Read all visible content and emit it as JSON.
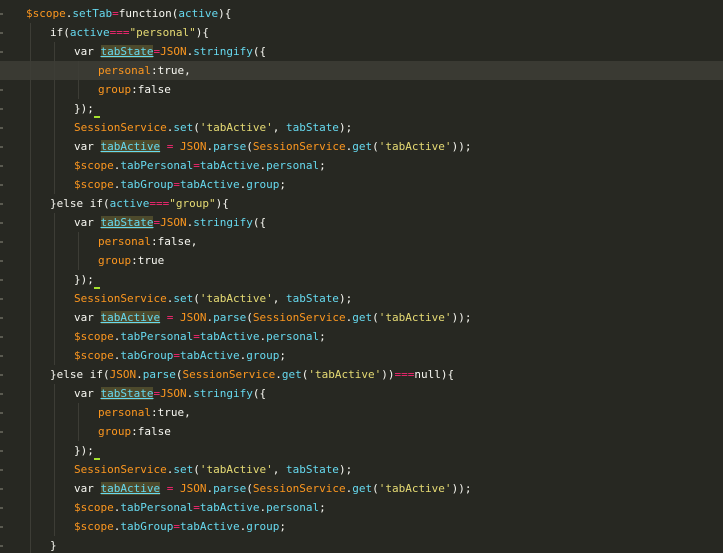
{
  "editor": {
    "top_fragment": "",
    "lines": [
      {
        "text": "$scope.setTab=function(active){",
        "indent": 0
      },
      {
        "text": "if(active===\"personal\"){",
        "indent": 1
      },
      {
        "text": "var tabState=JSON.stringify({",
        "indent": 2
      },
      {
        "text": "personal:true,",
        "indent": 3
      },
      {
        "text": "group:false",
        "indent": 3
      },
      {
        "text": "});",
        "indent": 2
      },
      {
        "text": "SessionService.set('tabActive', tabState);",
        "indent": 2
      },
      {
        "text": "var tabActive = JSON.parse(SessionService.get('tabActive'));",
        "indent": 2
      },
      {
        "text": "$scope.tabPersonal=tabActive.personal;",
        "indent": 2
      },
      {
        "text": "$scope.tabGroup=tabActive.group;",
        "indent": 2
      },
      {
        "text": "}else if(active===\"group\"){",
        "indent": 1
      },
      {
        "text": "var tabState=JSON.stringify({",
        "indent": 2
      },
      {
        "text": "personal:false,",
        "indent": 3
      },
      {
        "text": "group:true",
        "indent": 3
      },
      {
        "text": "});",
        "indent": 2
      },
      {
        "text": "SessionService.set('tabActive', tabState);",
        "indent": 2
      },
      {
        "text": "var tabActive = JSON.parse(SessionService.get('tabActive'));",
        "indent": 2
      },
      {
        "text": "$scope.tabPersonal=tabActive.personal;",
        "indent": 2
      },
      {
        "text": "$scope.tabGroup=tabActive.group;",
        "indent": 2
      },
      {
        "text": "}else if(JSON.parse(SessionService.get('tabActive'))===null){",
        "indent": 1
      },
      {
        "text": "var tabState=JSON.stringify({",
        "indent": 2
      },
      {
        "text": "personal:true,",
        "indent": 3
      },
      {
        "text": "group:false",
        "indent": 3
      },
      {
        "text": "});",
        "indent": 2
      },
      {
        "text": "SessionService.set('tabActive', tabState);",
        "indent": 2
      },
      {
        "text": "var tabActive = JSON.parse(SessionService.get('tabActive'));",
        "indent": 2
      },
      {
        "text": "$scope.tabPersonal=tabActive.personal;",
        "indent": 2
      },
      {
        "text": "$scope.tabGroup=tabActive.group;",
        "indent": 2
      },
      {
        "text": "}",
        "indent": 1
      }
    ]
  },
  "theme": {
    "background": "#272822",
    "active_line": "#3a3a33",
    "keyword": "#f8f8f2",
    "scope": "#fd971f",
    "identifier": "#66d9ef",
    "string": "#e6db74",
    "operator": "#f92672",
    "highlight": "#4d4a2c",
    "cursor": "#a6e22e"
  }
}
